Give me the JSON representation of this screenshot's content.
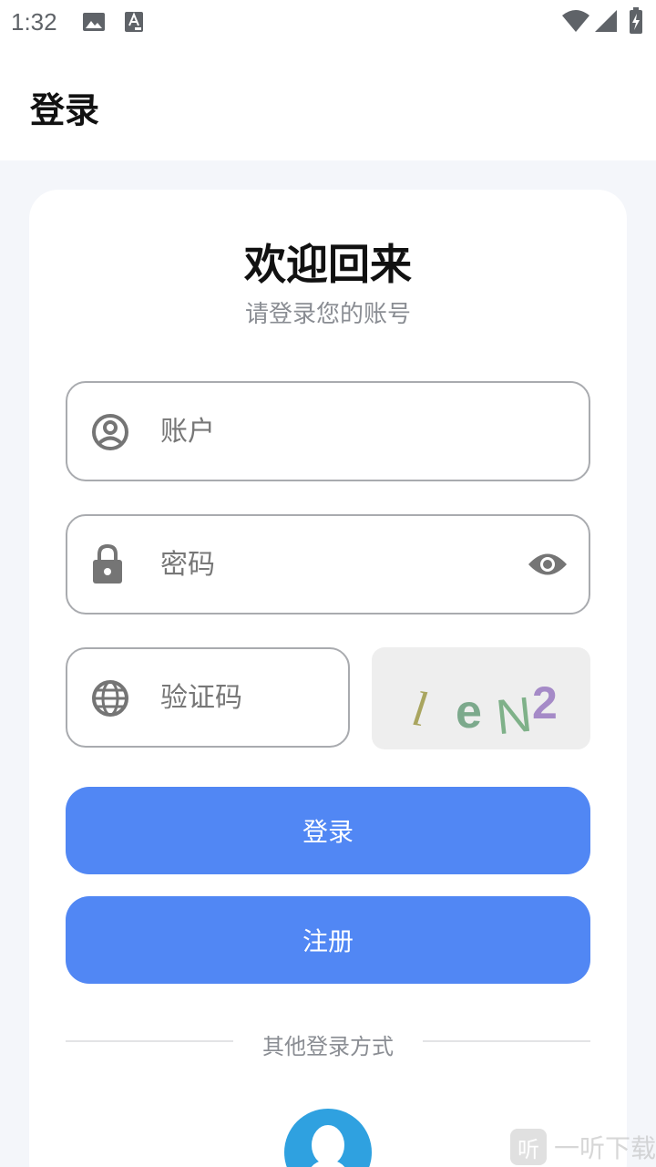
{
  "status_bar": {
    "time": "1:32",
    "icons": [
      "image-icon",
      "font-icon",
      "wifi-icon",
      "signal-icon",
      "battery-charging-icon"
    ]
  },
  "app_bar": {
    "title": "登录"
  },
  "card": {
    "title": "欢迎回来",
    "subtitle": "请登录您的账号",
    "account": {
      "placeholder": "账户",
      "value": "",
      "icon": "account-circle-icon"
    },
    "password": {
      "placeholder": "密码",
      "value": "",
      "icon": "lock-icon",
      "toggle_icon": "eye-icon"
    },
    "captcha": {
      "placeholder": "验证码",
      "value": "",
      "icon": "globe-icon",
      "image_text": "leN2"
    },
    "login_button": "登录",
    "register_button": "注册",
    "other_login_label": "其他登录方式",
    "other_login_icons": [
      "qq-icon"
    ]
  },
  "watermark": {
    "badge": "听",
    "text": "一听下载"
  },
  "colors": {
    "primary": "#5187f4",
    "qq": "#2fa1e0",
    "page_bg": "#f4f6fa"
  }
}
